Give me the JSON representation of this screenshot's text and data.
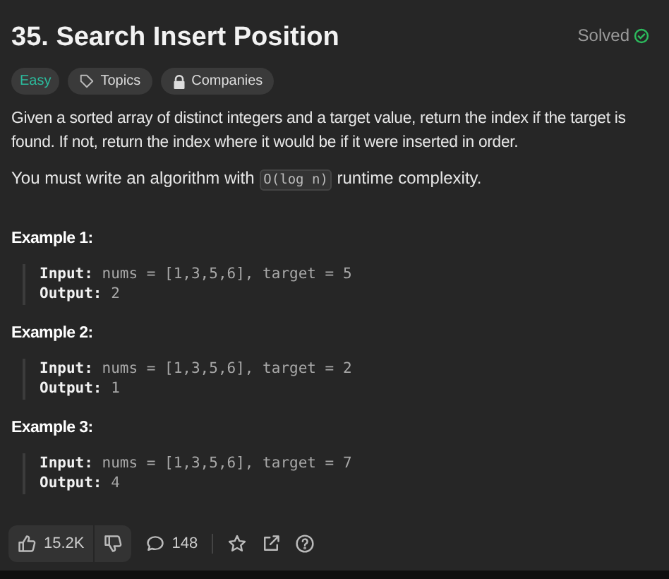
{
  "title": "35. Search Insert Position",
  "status": {
    "label": "Solved",
    "solved": true
  },
  "tags": [
    {
      "kind": "difficulty",
      "label": "Easy"
    },
    {
      "kind": "topics",
      "label": "Topics"
    },
    {
      "kind": "companies",
      "label": "Companies"
    }
  ],
  "description": "Given a sorted array of distinct integers and a target value, return the index if the target is found. If not, return the index where it would be if it were inserted in order.",
  "complexity": {
    "before": "You must write an algorithm with",
    "code": "O(log n)",
    "after": "runtime complexity."
  },
  "examples": [
    {
      "title": "Example 1:",
      "input": "**Input:** nums = [1,3,5,6], target = 5",
      "output": "**Output:** 2"
    },
    {
      "title": "Example 2:",
      "input": "**Input:** nums = [1,3,5,6], target = 2",
      "output": "**Output:** 1"
    },
    {
      "title": "Example 3:",
      "input": "**Input:** nums = [1,3,5,6], target = 7",
      "output": "**Output:** 4"
    }
  ],
  "footer": {
    "likes": "15.2K",
    "comments": "148"
  }
}
